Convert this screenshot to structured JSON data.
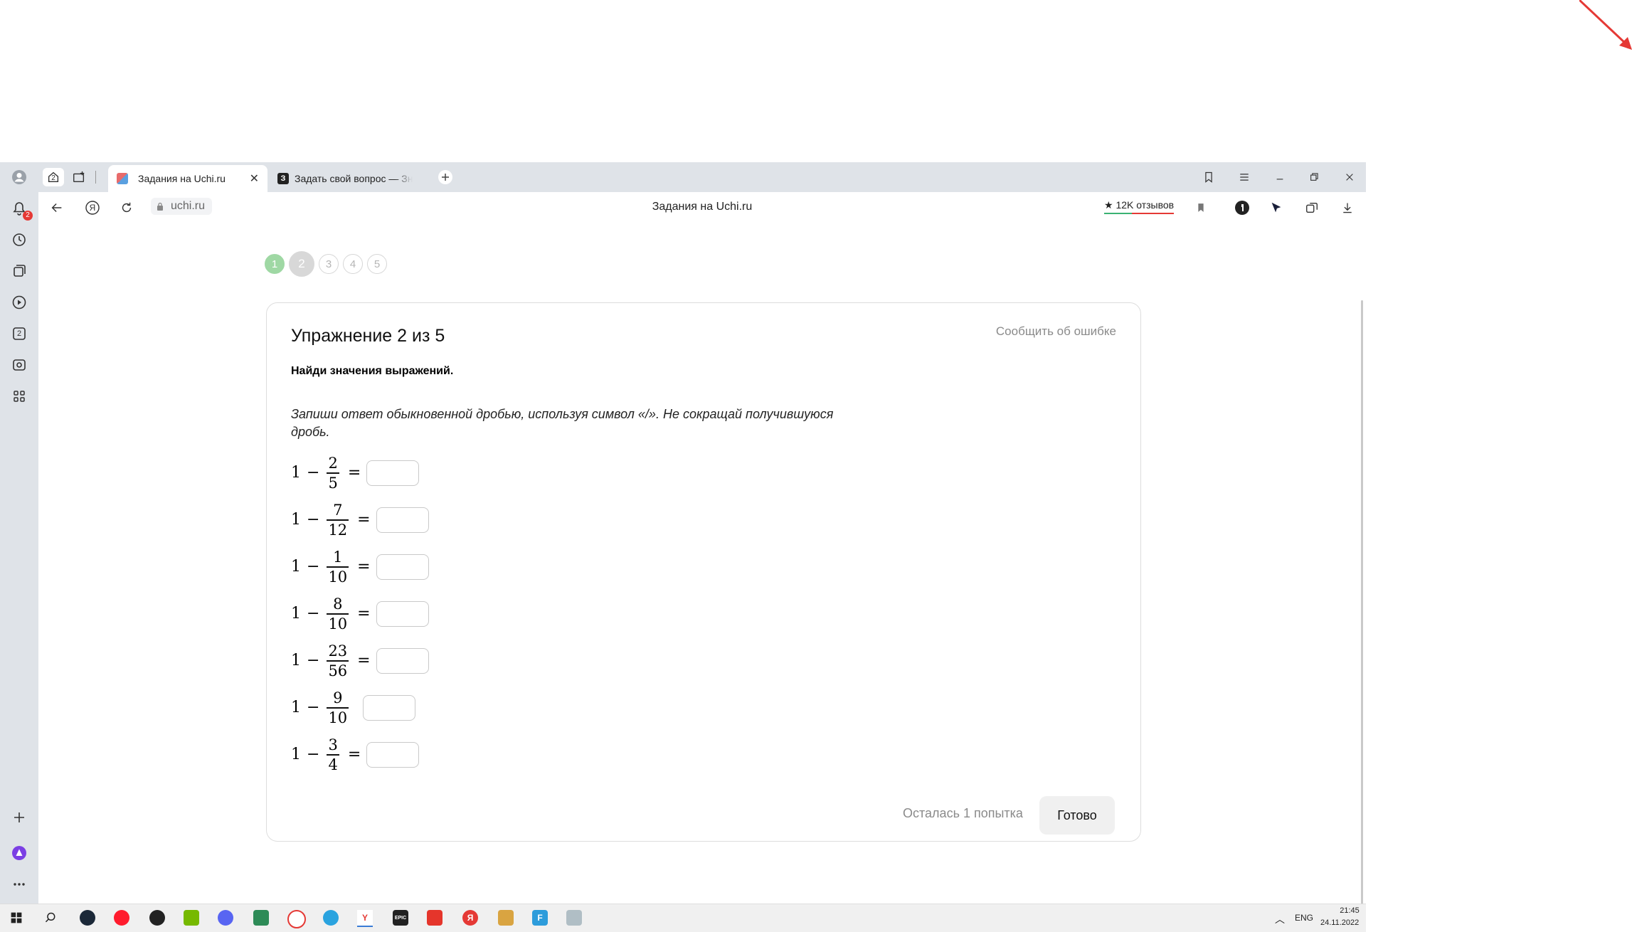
{
  "browser": {
    "tab_group_count": "2",
    "tabs": [
      {
        "label": "Задания на Uchi.ru",
        "active": true,
        "favicon_color": "#e86b6b"
      },
      {
        "label": "Задать свой вопрос — Зн",
        "active": false,
        "favicon_text": "З",
        "favicon_color": "#222222"
      }
    ],
    "new_tab_icon": "plus-icon",
    "window_controls": [
      "bookmarks-icon",
      "menu-icon",
      "minimize-icon",
      "restore-icon",
      "close-icon"
    ]
  },
  "address_bar": {
    "url": "uchi.ru",
    "page_title": "Задания на Uchi.ru",
    "reviews": "★ 12K отзывов",
    "yandex_letter": "Я"
  },
  "sidebar": {
    "notification_badge": "2",
    "collections_count": "2"
  },
  "steps": {
    "items": [
      "1",
      "2",
      "3",
      "4",
      "5"
    ],
    "done_color": "#9fd8a4",
    "current_color": "#d8d8d8"
  },
  "exercise": {
    "title": "Упражнение 2 из 5",
    "report_link": "Сообщить об ошибке",
    "instruction": "Найди значения выражений.",
    "hint": "Запиши ответ обыкновенной дробью, используя символ «/». Не сокращай получившуюся дробь.",
    "rows": [
      {
        "whole": "1",
        "op": "−",
        "num": "2",
        "den": "5",
        "eq": "=",
        "answer": ""
      },
      {
        "whole": "1",
        "op": "−",
        "num": "7",
        "den": "12",
        "eq": "=",
        "answer": ""
      },
      {
        "whole": "1",
        "op": "−",
        "num": "1",
        "den": "10",
        "eq": "=",
        "answer": ""
      },
      {
        "whole": "1",
        "op": "−",
        "num": "8",
        "den": "10",
        "eq": "=",
        "answer": ""
      },
      {
        "whole": "1",
        "op": "−",
        "num": "23",
        "den": "56",
        "eq": "=",
        "answer": ""
      },
      {
        "whole": "1",
        "op": "−",
        "num": "9",
        "den": "10",
        "eq": "",
        "answer": ""
      },
      {
        "whole": "1",
        "op": "−",
        "num": "3",
        "den": "4",
        "eq": "=",
        "answer": ""
      }
    ],
    "attempts_left": "Осталась 1 попытка",
    "submit_label": "Готово"
  },
  "taskbar": {
    "lang": "ENG",
    "time": "21:45",
    "date": "24.11.2022"
  }
}
